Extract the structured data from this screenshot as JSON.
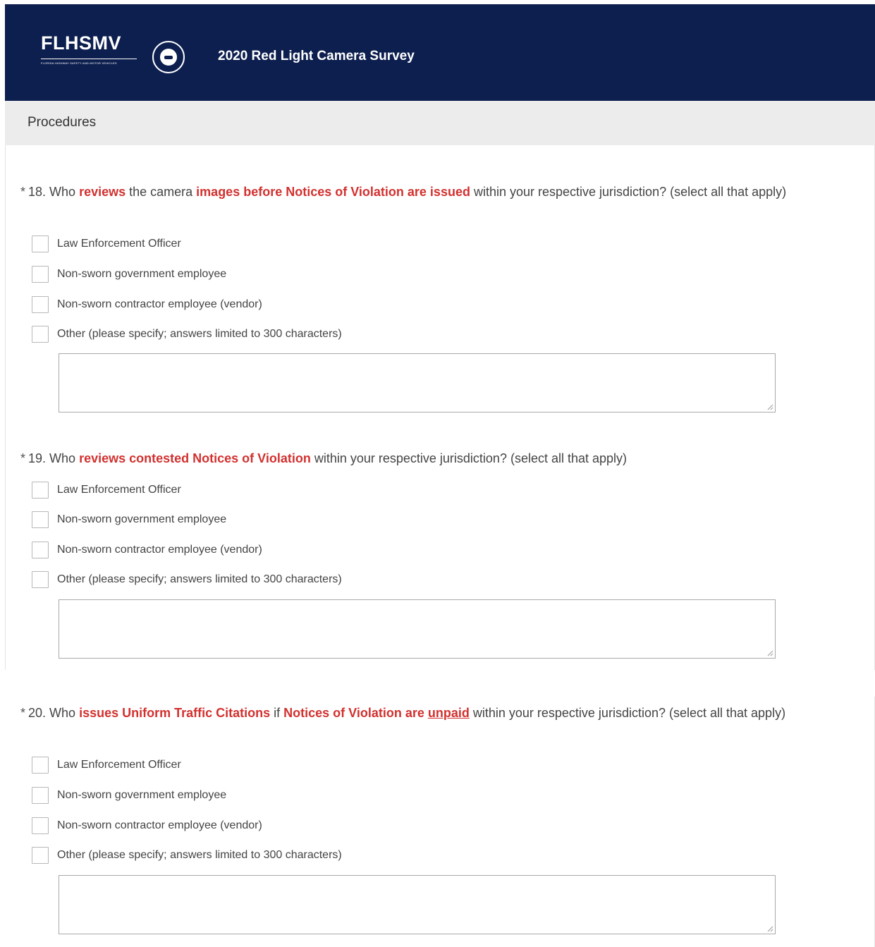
{
  "header": {
    "logo_text": "FLHSMV",
    "logo_subtext": "FLORIDA HIGHWAY SAFETY AND MOTOR VEHICLES",
    "title": "2020 Red Light Camera Survey"
  },
  "section": {
    "title": "Procedures"
  },
  "questions": [
    {
      "required_marker": "*",
      "segments": [
        {
          "text": "18. Who ",
          "style": "plain"
        },
        {
          "text": "reviews",
          "style": "hl"
        },
        {
          "text": " the camera ",
          "style": "plain"
        },
        {
          "text": "images before Notices of Violation are issued",
          "style": "hl"
        },
        {
          "text": " within your respective jurisdiction? (select all that apply)",
          "style": "plain"
        }
      ],
      "options": [
        "Law Enforcement Officer",
        "Non-sworn government employee",
        "Non-sworn contractor employee (vendor)",
        "Other (please specify; answers limited to 300 characters)"
      ],
      "other_value": ""
    },
    {
      "required_marker": "*",
      "segments": [
        {
          "text": "19. Who ",
          "style": "plain"
        },
        {
          "text": "reviews contested Notices of Violation",
          "style": "hl"
        },
        {
          "text": " within your respective jurisdiction? (select all that apply)",
          "style": "plain"
        }
      ],
      "options": [
        "Law Enforcement Officer",
        "Non-sworn government employee",
        "Non-sworn contractor employee (vendor)",
        "Other (please specify; answers limited to 300 characters)"
      ],
      "other_value": ""
    },
    {
      "required_marker": "*",
      "segments": [
        {
          "text": "20. Who ",
          "style": "plain"
        },
        {
          "text": "issues Uniform Traffic Citations",
          "style": "hl"
        },
        {
          "text": " if ",
          "style": "plain"
        },
        {
          "text": "Notices of Violation are ",
          "style": "hl"
        },
        {
          "text": "unpaid",
          "style": "hl-u"
        },
        {
          "text": " within your respective jurisdiction? (select all that apply)",
          "style": "plain"
        }
      ],
      "options": [
        "Law Enforcement Officer",
        "Non-sworn government employee",
        "Non-sworn contractor employee (vendor)",
        "Other (please specify; answers limited to 300 characters)"
      ],
      "other_value": ""
    }
  ],
  "colors": {
    "header_bg": "#0d1f4f",
    "section_bg": "#ececec",
    "highlight": "#d2312f"
  }
}
